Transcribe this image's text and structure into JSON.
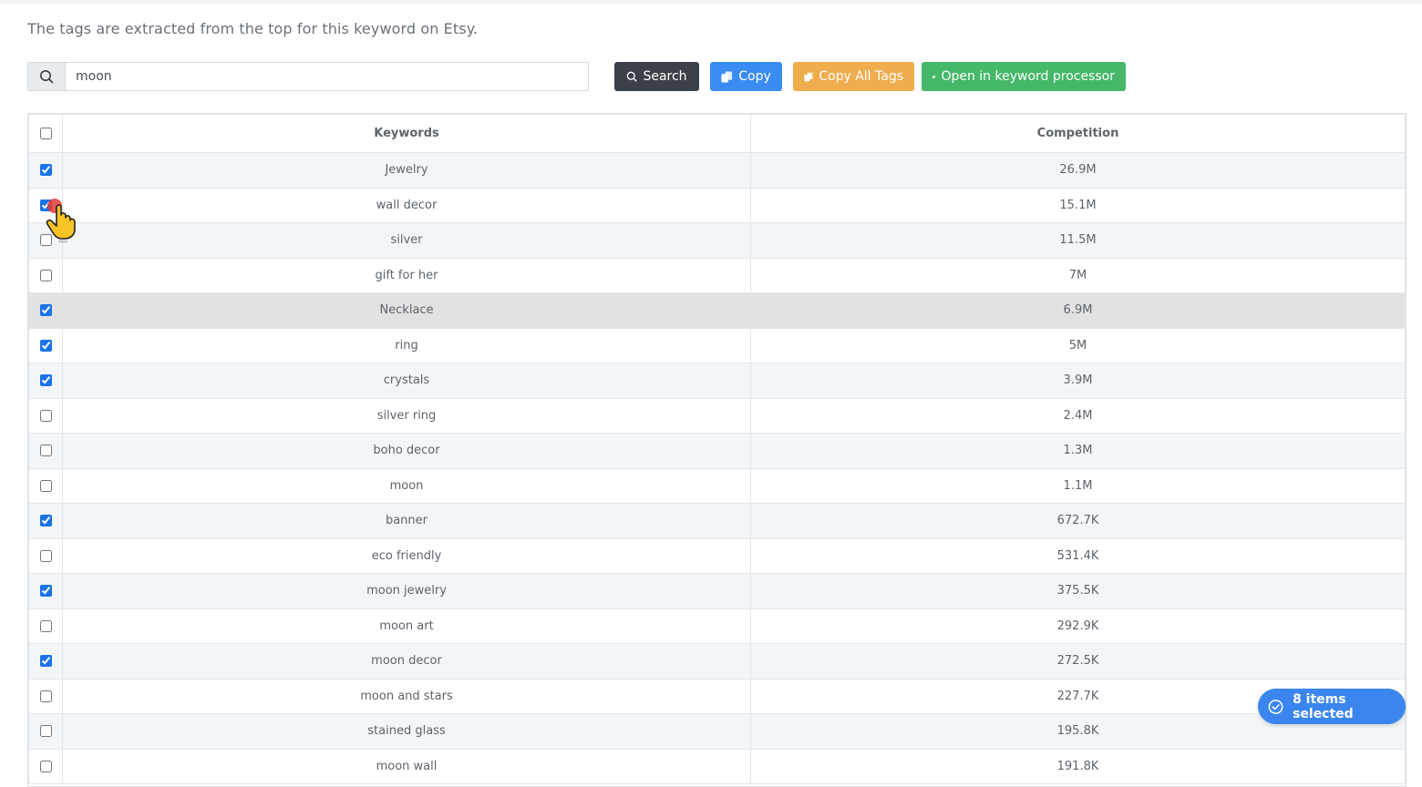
{
  "intro_text": "The tags are extracted from the top for this keyword on Etsy.",
  "search": {
    "value": "moon",
    "placeholder": ""
  },
  "buttons": {
    "search": "Search",
    "copy": "Copy",
    "copy_all": "Copy All Tags",
    "open_processor": "Open in keyword processor"
  },
  "table": {
    "headers": {
      "keywords": "Keywords",
      "competition": "Competition"
    },
    "rows": [
      {
        "keyword": "Jewelry",
        "competition": "26.9M",
        "checked": true
      },
      {
        "keyword": "wall decor",
        "competition": "15.1M",
        "checked": true
      },
      {
        "keyword": "silver",
        "competition": "11.5M",
        "checked": false
      },
      {
        "keyword": "gift for her",
        "competition": "7M",
        "checked": false
      },
      {
        "keyword": "Necklace",
        "competition": "6.9M",
        "checked": true
      },
      {
        "keyword": "ring",
        "competition": "5M",
        "checked": true
      },
      {
        "keyword": "crystals",
        "competition": "3.9M",
        "checked": true
      },
      {
        "keyword": "silver ring",
        "competition": "2.4M",
        "checked": false
      },
      {
        "keyword": "boho decor",
        "competition": "1.3M",
        "checked": false
      },
      {
        "keyword": "moon",
        "competition": "1.1M",
        "checked": false
      },
      {
        "keyword": "banner",
        "competition": "672.7K",
        "checked": true
      },
      {
        "keyword": "eco friendly",
        "competition": "531.4K",
        "checked": false
      },
      {
        "keyword": "moon jewelry",
        "competition": "375.5K",
        "checked": true
      },
      {
        "keyword": "moon art",
        "competition": "292.9K",
        "checked": false
      },
      {
        "keyword": "moon decor",
        "competition": "272.5K",
        "checked": true
      },
      {
        "keyword": "moon and stars",
        "competition": "227.7K",
        "checked": false
      },
      {
        "keyword": "stained glass",
        "competition": "195.8K",
        "checked": false
      },
      {
        "keyword": "moon wall",
        "competition": "191.8K",
        "checked": false
      }
    ]
  },
  "selection_badge": "8 items selected",
  "colors": {
    "search_button": "#3c4149",
    "copy_button": "#3b8cf2",
    "copy_all_button": "#f0ad4e",
    "open_button": "#45b869",
    "badge": "#3b86ee"
  }
}
